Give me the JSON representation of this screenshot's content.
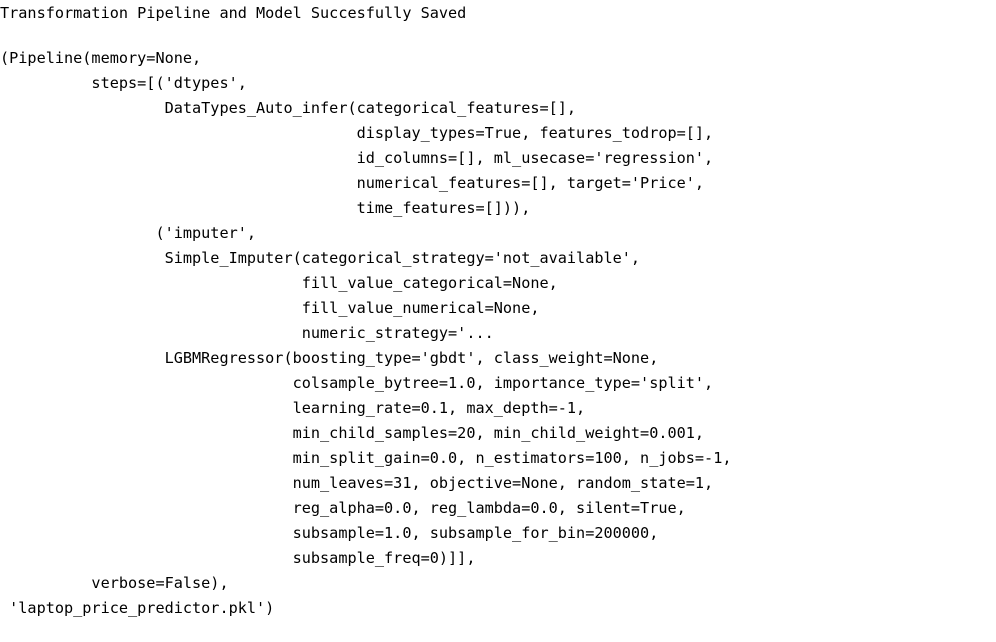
{
  "output": {
    "status_message": "Transformation Pipeline and Model Succesfully Saved",
    "lines": [
      "(Pipeline(memory=None,",
      "          steps=[('dtypes',",
      "                  DataTypes_Auto_infer(categorical_features=[],",
      "                                       display_types=True, features_todrop=[],",
      "                                       id_columns=[], ml_usecase='regression',",
      "                                       numerical_features=[], target='Price',",
      "                                       time_features=[])),",
      "                 ('imputer',",
      "                  Simple_Imputer(categorical_strategy='not_available',",
      "                                 fill_value_categorical=None,",
      "                                 fill_value_numerical=None,",
      "                                 numeric_strategy='...",
      "                  LGBMRegressor(boosting_type='gbdt', class_weight=None,",
      "                                colsample_bytree=1.0, importance_type='split',",
      "                                learning_rate=0.1, max_depth=-1,",
      "                                min_child_samples=20, min_child_weight=0.001,",
      "                                min_split_gain=0.0, n_estimators=100, n_jobs=-1,",
      "                                num_leaves=31, objective=None, random_state=1,",
      "                                reg_alpha=0.0, reg_lambda=0.0, silent=True,",
      "                                subsample=1.0, subsample_for_bin=200000,",
      "                                subsample_freq=0)]],",
      "          verbose=False),",
      " 'laptop_price_predictor.pkl')"
    ]
  }
}
